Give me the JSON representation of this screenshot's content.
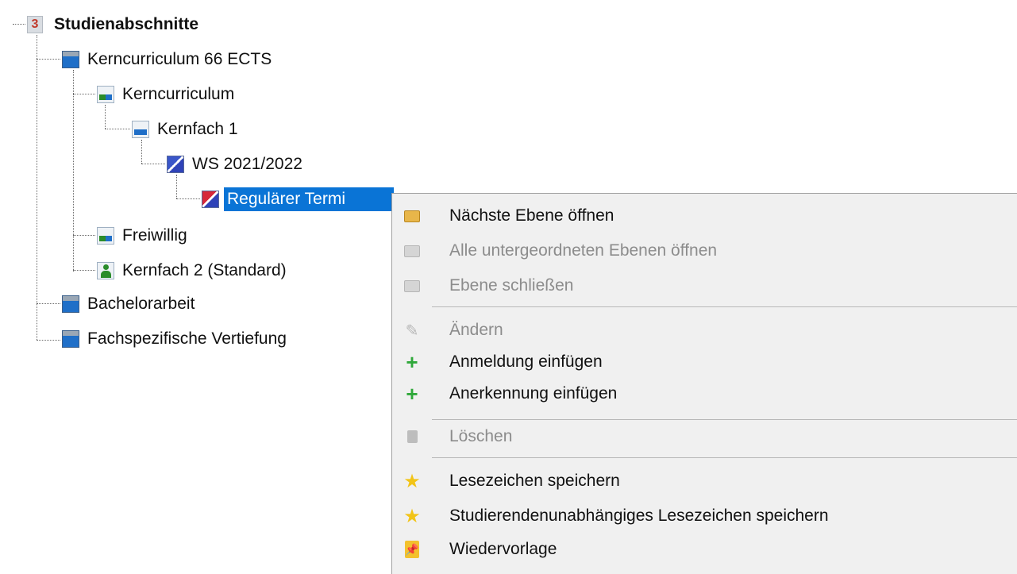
{
  "tree": {
    "root": {
      "badge": "3",
      "label": "Studienabschnitte"
    },
    "nodes": {
      "kerncurriculum_66": "Kerncurriculum  66 ECTS",
      "kerncurriculum": "Kerncurriculum",
      "kernfach1": "Kernfach 1",
      "ws": "WS 2021/2022",
      "regular": "Regulärer Termi",
      "freiwillig": "Freiwillig",
      "kernfach2": "Kernfach 2  (Standard)",
      "bachelor": "Bachelorarbeit",
      "fachspez": "Fachspezifische Vertiefung"
    }
  },
  "menu": {
    "items": [
      {
        "label": "Nächste Ebene öffnen",
        "icon": "folder-open-icon",
        "enabled": true
      },
      {
        "label": "Alle untergeordneten Ebenen öffnen",
        "icon": "folder-expand-icon",
        "enabled": false
      },
      {
        "label": "Ebene schließen",
        "icon": "folder-closed-icon",
        "enabled": false
      },
      {
        "label": "Ändern",
        "icon": "pencil-icon",
        "enabled": false
      },
      {
        "label": "Anmeldung einfügen",
        "icon": "plus-icon",
        "enabled": true
      },
      {
        "label": "Anerkennung einfügen",
        "icon": "plus-icon",
        "enabled": true
      },
      {
        "label": "Löschen",
        "icon": "trash-icon",
        "enabled": false
      },
      {
        "label": "Lesezeichen speichern",
        "icon": "star-icon",
        "enabled": true
      },
      {
        "label": "Studierendenunabhängiges Lesezeichen speichern",
        "icon": "star-icon",
        "enabled": true
      },
      {
        "label": "Wiedervorlage",
        "icon": "notepad-icon",
        "enabled": true
      }
    ]
  },
  "colors": {
    "selection": "#0a74d6",
    "plus": "#2fa83a",
    "star": "#f2c418"
  }
}
